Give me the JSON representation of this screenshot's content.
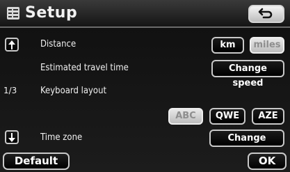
{
  "header": {
    "title": "Setup",
    "back_icon": "back-arrow-icon",
    "setup_icon": "setup-list-icon"
  },
  "rows": {
    "distance": {
      "label": "Distance",
      "options": [
        {
          "label": "km",
          "selected": false
        },
        {
          "label": "miles",
          "selected": true
        }
      ]
    },
    "travel_time": {
      "label": "Estimated travel time",
      "button": "Change speed"
    },
    "keyboard": {
      "label": "Keyboard layout",
      "options": [
        {
          "label": "ABC",
          "selected": true
        },
        {
          "label": "QWE",
          "selected": false
        },
        {
          "label": "AZE",
          "selected": false
        }
      ]
    },
    "time_zone": {
      "label": "Time zone",
      "button": "Change"
    }
  },
  "pagination": {
    "indicator": "1/3",
    "up_icon": "scroll-up-icon",
    "down_icon": "scroll-down-icon"
  },
  "footer": {
    "default_label": "Default",
    "ok_label": "OK"
  },
  "colors": {
    "background": "#111111",
    "button_border": "#c9c9c9",
    "selected_fill": "#d4d4d4",
    "selected_text": "#8e8e8e"
  }
}
